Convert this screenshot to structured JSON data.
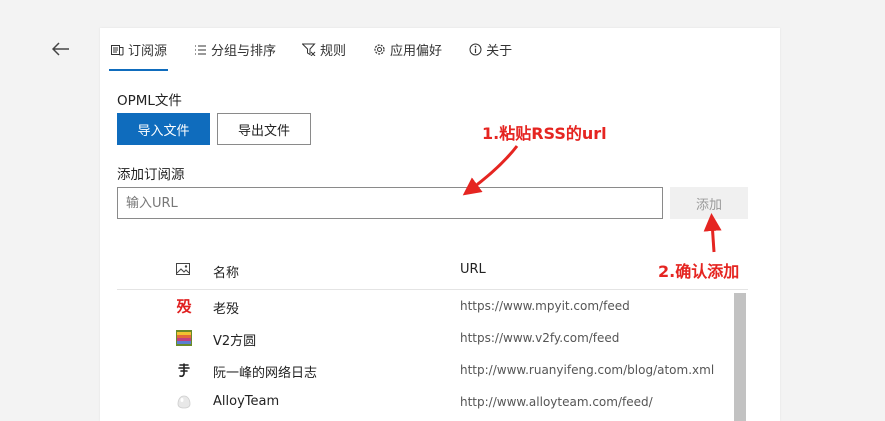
{
  "tabs": [
    {
      "label": "订阅源",
      "icon": "feed-list-icon",
      "active": true
    },
    {
      "label": "分组与排序",
      "icon": "list-icon",
      "active": false
    },
    {
      "label": "规则",
      "icon": "filter-icon",
      "active": false
    },
    {
      "label": "应用偏好",
      "icon": "gear-icon",
      "active": false
    },
    {
      "label": "关于",
      "icon": "info-icon",
      "active": false
    }
  ],
  "opml": {
    "label": "OPML文件",
    "import_label": "导入文件",
    "export_label": "导出文件"
  },
  "add_feed": {
    "label": "添加订阅源",
    "placeholder": "输入URL",
    "value": "",
    "add_label": "添加"
  },
  "list": {
    "header_icon": "image-icon",
    "col_name": "名称",
    "col_url": "URL",
    "rows": [
      {
        "name": "老殁",
        "url": "https://www.mpyit.com/feed",
        "icon": "mpyit-favicon"
      },
      {
        "name": "V2方圆",
        "url": "https://www.v2fy.com/feed",
        "icon": "v2fy-favicon"
      },
      {
        "name": "阮一峰的网络日志",
        "url": "http://www.ruanyifeng.com/blog/atom.xml",
        "icon": "ruanyifeng-favicon"
      },
      {
        "name": "AlloyTeam",
        "url": "http://www.alloyteam.com/feed/",
        "icon": "alloyteam-favicon"
      }
    ]
  },
  "annotations": {
    "step1": "1.粘贴RSS的url",
    "step2": "2.确认添加"
  },
  "colors": {
    "accent": "#0f6cbd",
    "annotation": "#e52521"
  }
}
